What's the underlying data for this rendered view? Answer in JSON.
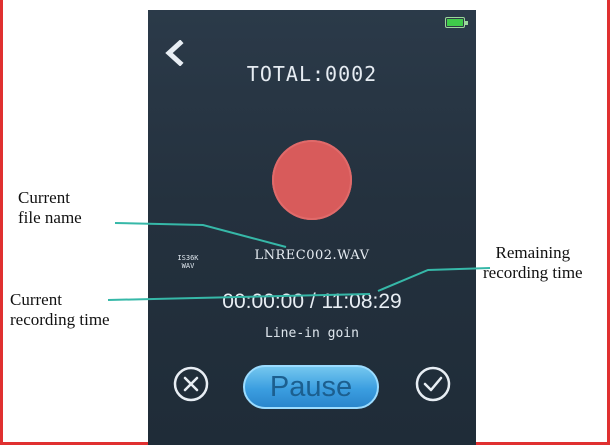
{
  "device": {
    "total_label": "TOTAL:0002",
    "format_badge": [
      "IS36K",
      "WAV"
    ],
    "current_file": "LNREC002.WAV",
    "current_time": "00:00:00",
    "separator": "/",
    "remaining_time": "11:08:29",
    "input_mode": "Line-in goin",
    "pause_label": "Pause",
    "icons": {
      "back": "chevron-left-icon",
      "battery": "battery-icon",
      "cancel": "close-circle-icon",
      "confirm": "check-circle-icon"
    },
    "colors": {
      "record": "#d85b5b",
      "pause": "#3b9ee0",
      "battery": "#3fcc4a",
      "accent": "#36b8a8"
    }
  },
  "annotations": {
    "file_name": [
      "Current",
      "file name"
    ],
    "current_time": [
      "Current",
      "recording time"
    ],
    "remaining_time": [
      "Remaining",
      "recording time"
    ]
  }
}
